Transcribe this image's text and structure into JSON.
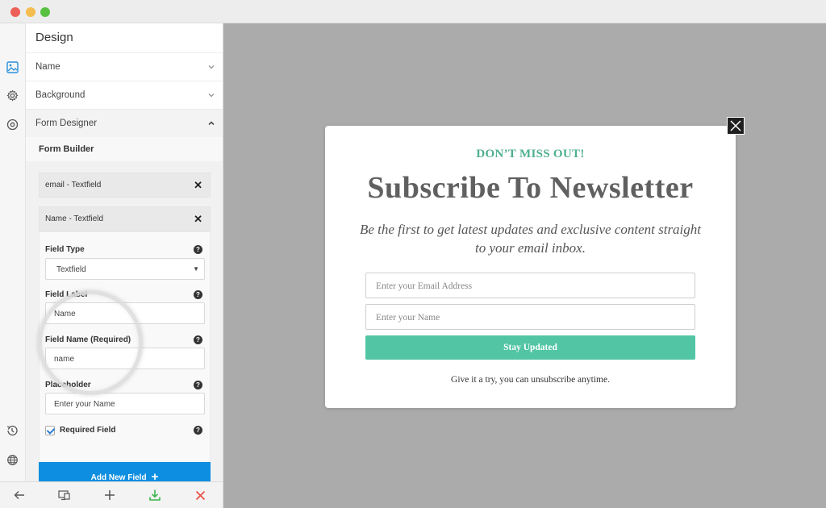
{
  "window": {
    "controls": [
      {
        "name": "close",
        "color": "#ec5f57"
      },
      {
        "name": "minimize",
        "color": "#f5bd4f"
      },
      {
        "name": "maximize",
        "color": "#58c141"
      }
    ]
  },
  "rail": {
    "top_icons": [
      "image-icon",
      "gear-icon",
      "target-icon"
    ],
    "bottom_icons": [
      "history-icon",
      "globe-icon"
    ],
    "active_color": "#2a8fd9"
  },
  "sidebar": {
    "title": "Design",
    "sections": [
      {
        "label": "Name",
        "expanded": false
      },
      {
        "label": "Background",
        "expanded": false
      },
      {
        "label": "Form Designer",
        "expanded": true
      }
    ],
    "form_builder": {
      "title": "Form Builder",
      "fields": [
        {
          "label": "email - Textfield"
        },
        {
          "label": "Name - Textfield"
        }
      ],
      "remove_glyph": "✕",
      "settings": {
        "field_type_label": "Field Type",
        "field_type_value": "Textfield",
        "field_label_label": "Field Label",
        "field_label_value": "Name",
        "field_name_label": "Field Name (Required)",
        "field_name_value": "name",
        "placeholder_label": "Placeholder",
        "placeholder_value": "Enter your Name",
        "required_label": "Required Field",
        "required_checked": true,
        "help_glyph": "?"
      },
      "add_button_label": "Add New Field",
      "add_button_glyph": "+",
      "add_button_color": "#0e8ee0"
    }
  },
  "bottom_toolbar": {
    "icons": [
      "back-arrow-icon",
      "responsive-view-icon",
      "plus-icon",
      "download-icon",
      "close-icon"
    ],
    "download_color": "#3bb54a",
    "close_color": "#e84c3d"
  },
  "canvas": {
    "background": "#ababab",
    "popup": {
      "eyebrow": "DON’T MISS OUT!",
      "headline": "Subscribe To Newsletter",
      "subtext": "Be the first to get latest updates and exclusive content straight to your email inbox.",
      "email_placeholder": "Enter your Email Address",
      "name_placeholder": "Enter your Name",
      "button_label": "Stay Updated",
      "fine_print": "Give it a try, you can unsubscribe anytime.",
      "accent_color": "#4fb08d",
      "button_color": "#52c5a4"
    }
  }
}
